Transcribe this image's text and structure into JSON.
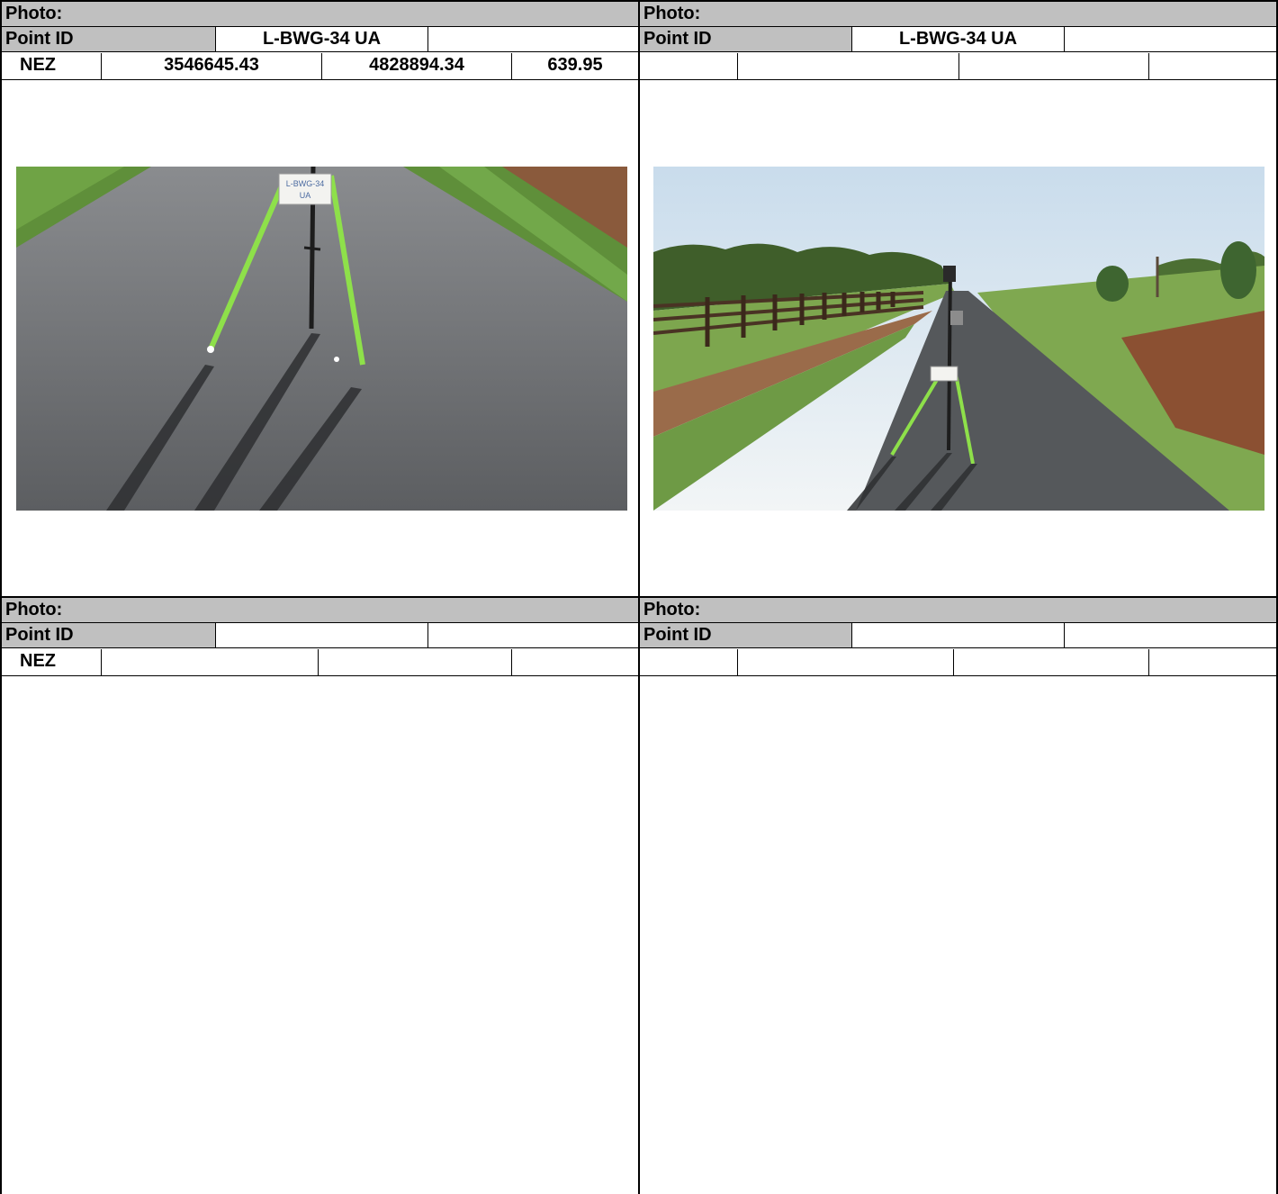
{
  "panels": [
    {
      "photo_label": "Photo:",
      "point_id_label": "Point ID",
      "point_id_value": "L-BWG-34 UA",
      "point_id_extra": "",
      "nez_label": "NEZ",
      "nez_n": "3546645.43",
      "nez_e": "4828894.34",
      "nez_z": "639.95",
      "photo": {
        "sign_text_line1": "L-BWG-34",
        "sign_text_line2": "UA"
      }
    },
    {
      "photo_label": "Photo:",
      "point_id_label": "Point ID",
      "point_id_value": "L-BWG-34 UA",
      "point_id_extra": "",
      "nez_label": "",
      "nez_n": "",
      "nez_e": "",
      "nez_z": ""
    },
    {
      "photo_label": "Photo:",
      "point_id_label": "Point ID",
      "point_id_value": "",
      "point_id_extra": "",
      "nez_label": "NEZ",
      "nez_n": "",
      "nez_e": "",
      "nez_z": ""
    },
    {
      "photo_label": "Photo:",
      "point_id_label": "Point ID",
      "point_id_value": "",
      "point_id_extra": "",
      "nez_label": "",
      "nez_n": "",
      "nez_e": "",
      "nez_z": ""
    }
  ],
  "colors": {
    "header_gray": "#c0c0c0",
    "asphalt": "#6e7073",
    "grass": "#5f8f3a",
    "tripod_leg": "#8ee04a",
    "sky": "#dde8f2"
  }
}
